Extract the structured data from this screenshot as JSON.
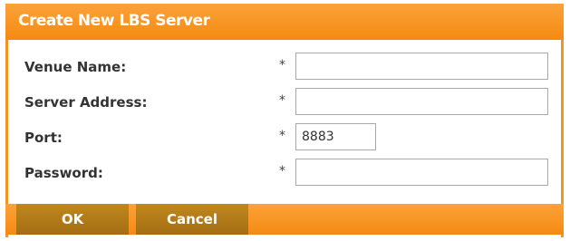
{
  "dialog": {
    "title": "Create New LBS Server",
    "fields": [
      {
        "label": "Venue Name:",
        "required_mark": "*",
        "value": ""
      },
      {
        "label": "Server Address:",
        "required_mark": "*",
        "value": ""
      },
      {
        "label": "Port:",
        "required_mark": "*",
        "value": "8883"
      },
      {
        "label": "Password:",
        "required_mark": "*",
        "value": ""
      }
    ],
    "buttons": {
      "ok": "OK",
      "cancel": "Cancel"
    }
  },
  "colors": {
    "accent": "#f7941d",
    "button": "#b07a18"
  }
}
